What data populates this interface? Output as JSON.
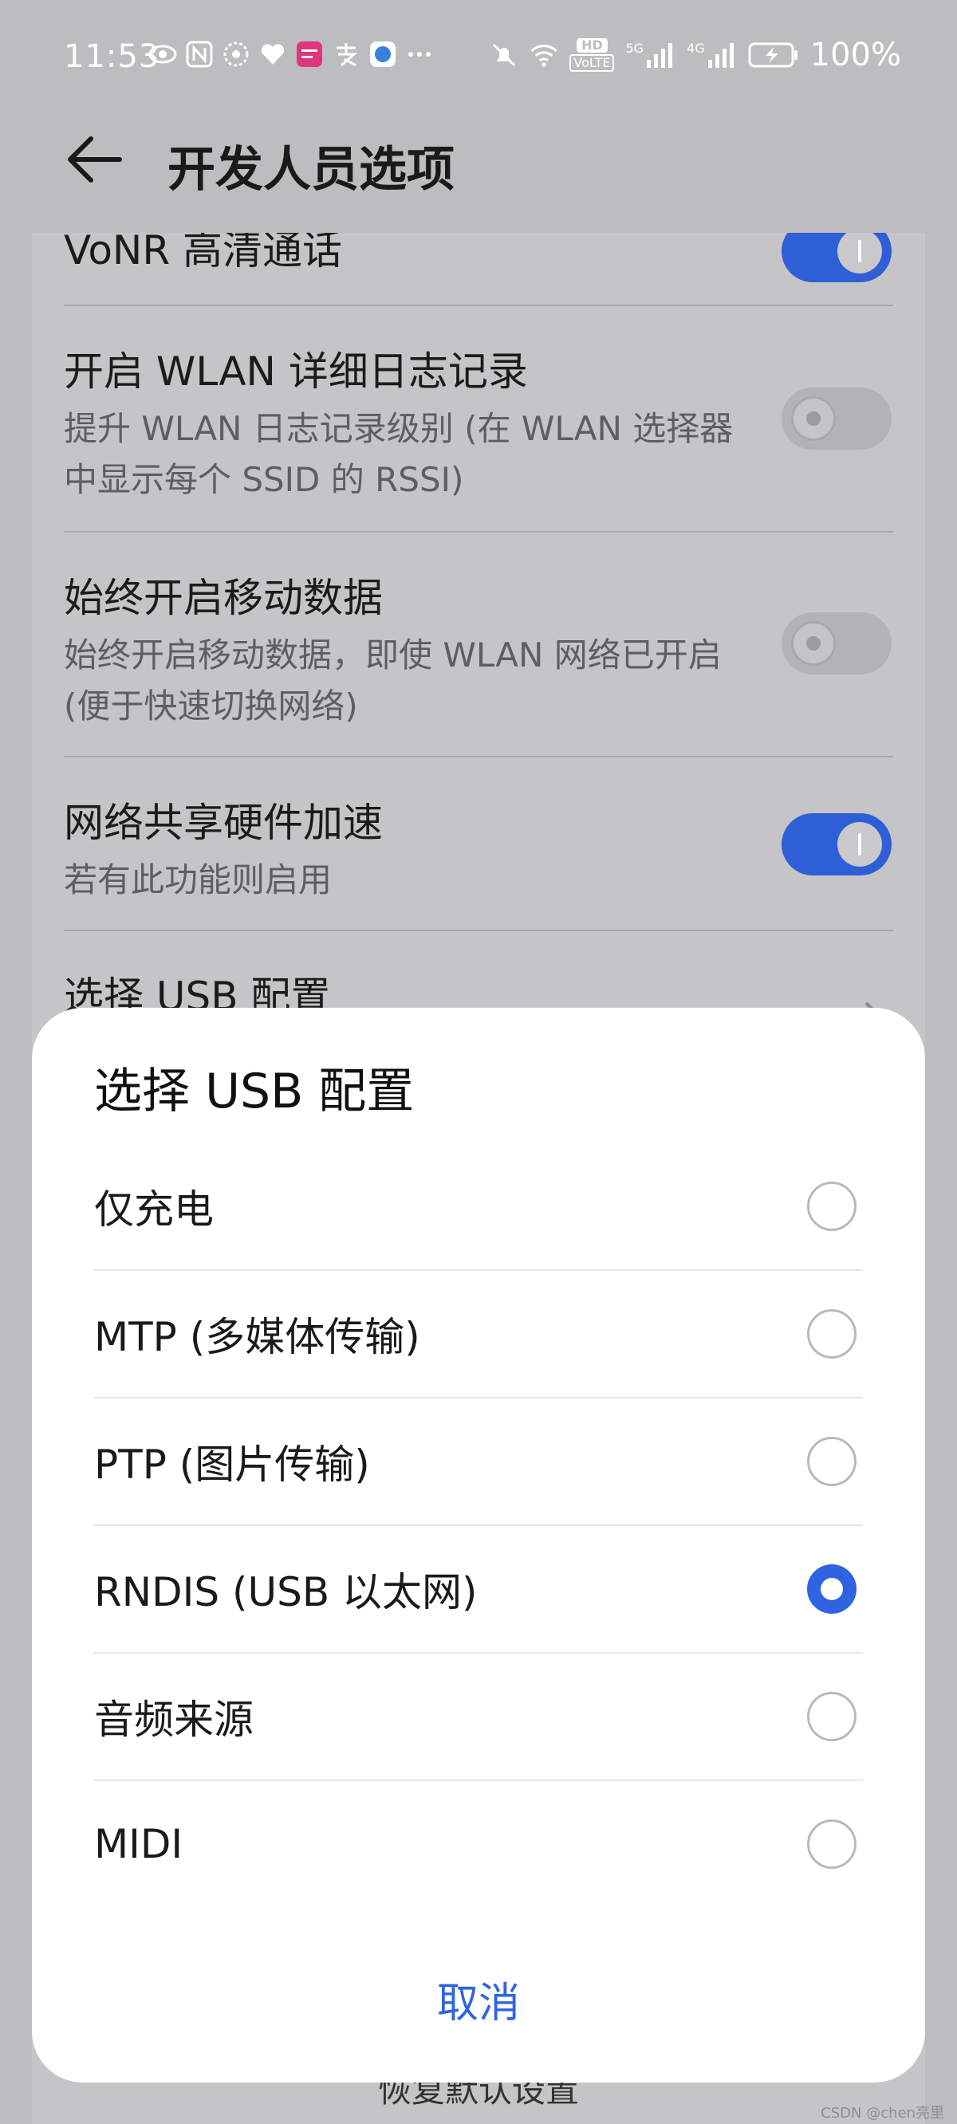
{
  "status_bar": {
    "time": "11:53",
    "battery_percent": "100%",
    "net_label": "HD",
    "net_sub": "VoLTE",
    "sig1": "5G",
    "sig2": "4G"
  },
  "header": {
    "title": "开发人员选项"
  },
  "settings": {
    "items": [
      {
        "title": "VoNR 高清通话",
        "desc": "",
        "toggle": "on"
      },
      {
        "title": "开启 WLAN 详细日志记录",
        "desc": "提升 WLAN 日志记录级别 (在 WLAN 选择器中显示每个 SSID 的 RSSI)",
        "toggle": "off"
      },
      {
        "title": "始终开启移动数据",
        "desc": "始终开启移动数据，即使 WLAN 网络已开启 (便于快速切换网络)",
        "toggle": "off"
      },
      {
        "title": "网络共享硬件加速",
        "desc": "若有此功能则启用",
        "toggle": "on"
      },
      {
        "title": "选择 USB 配置",
        "desc": ""
      }
    ],
    "restore_label": "恢复默认设置"
  },
  "dialog": {
    "title": "选择 USB 配置",
    "options": [
      {
        "label": "仅充电",
        "selected": false
      },
      {
        "label": "MTP (多媒体传输)",
        "selected": false
      },
      {
        "label": "PTP (图片传输)",
        "selected": false
      },
      {
        "label": "RNDIS (USB 以太网)",
        "selected": true
      },
      {
        "label": "音频来源",
        "selected": false
      },
      {
        "label": "MIDI",
        "selected": false
      }
    ],
    "cancel_label": "取消"
  },
  "watermark": "CSDN @chen亮里",
  "colors": {
    "accent": "#2f63e2",
    "toggle_on": "#2e5fd6",
    "scrim": "#bdbdbf"
  }
}
